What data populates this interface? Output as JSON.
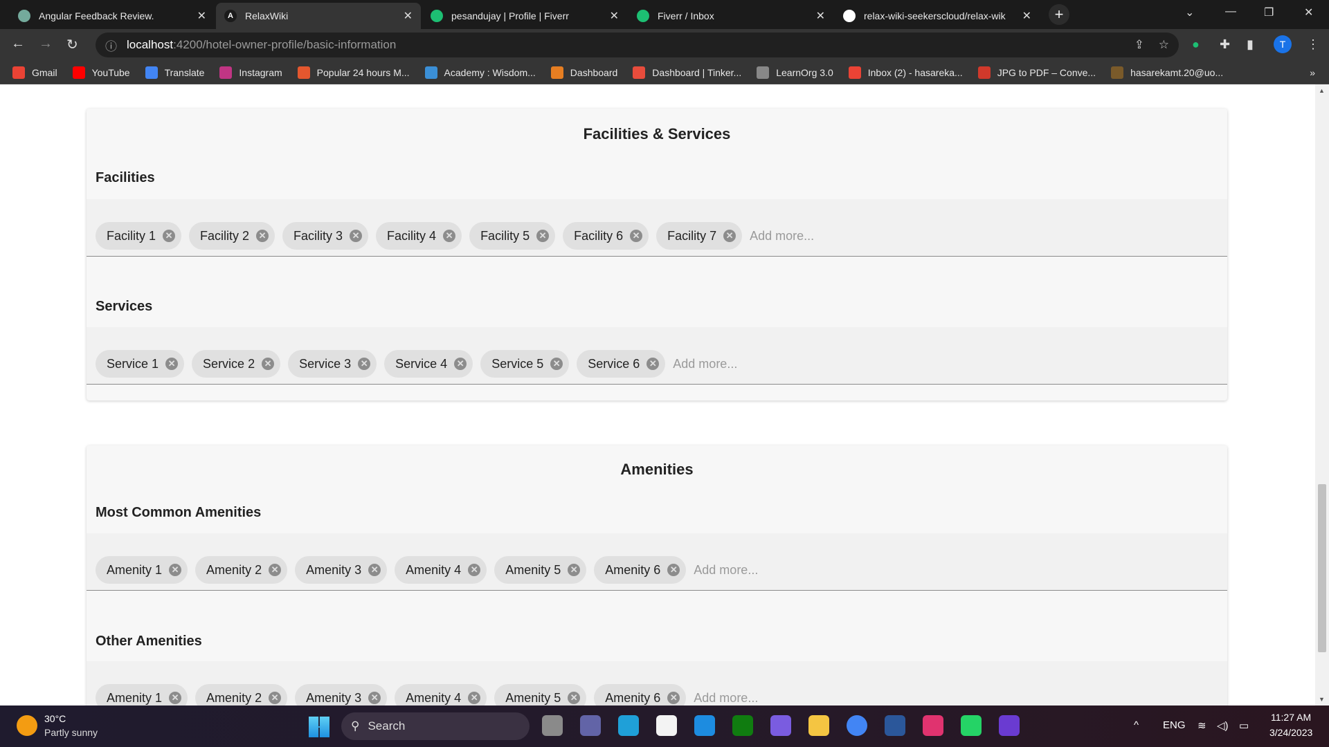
{
  "browser": {
    "tabs": [
      {
        "title": "Angular Feedback Review.",
        "icon": "chatgpt-icon",
        "color": "#74aa9c"
      },
      {
        "title": "RelaxWiki",
        "icon": "angular-icon",
        "color": "#1b1b1b",
        "active": true
      },
      {
        "title": "pesandujay | Profile | Fiverr",
        "icon": "fiverr-icon",
        "color": "#1dbf73"
      },
      {
        "title": "Fiverr / Inbox",
        "icon": "fiverr-icon",
        "color": "#1dbf73"
      },
      {
        "title": "relax-wiki-seekerscloud/relax-wik",
        "icon": "github-icon",
        "color": "#ffffff"
      }
    ],
    "url_host": "localhost",
    "url_path": ":4200/hotel-owner-profile/basic-information",
    "profile_initial": "T",
    "bookmarks": [
      {
        "label": "Gmail",
        "color": "#ea4335"
      },
      {
        "label": "YouTube",
        "color": "#ff0000"
      },
      {
        "label": "Translate",
        "color": "#4285f4"
      },
      {
        "label": "Instagram",
        "color": "#c13584"
      },
      {
        "label": "Popular 24 hours M...",
        "color": "#e4572e"
      },
      {
        "label": "Academy : Wisdom...",
        "color": "#3b8fd6"
      },
      {
        "label": "Dashboard",
        "color": "#e67e22"
      },
      {
        "label": "Dashboard | Tinker...",
        "color": "#e74c3c"
      },
      {
        "label": "LearnOrg 3.0",
        "color": "#888888"
      },
      {
        "label": "Inbox (2) - hasareka...",
        "color": "#ea4335"
      },
      {
        "label": "JPG to PDF – Conve...",
        "color": "#d0392b"
      },
      {
        "label": "hasarekamt.20@uo...",
        "color": "#7a5a2a"
      }
    ],
    "bookmarks_overflow": "»"
  },
  "facilities_services": {
    "title": "Facilities & Services",
    "facilities_label": "Facilities",
    "facilities": [
      "Facility 1",
      "Facility 2",
      "Facility 3",
      "Facility 4",
      "Facility 5",
      "Facility 6",
      "Facility 7"
    ],
    "services_label": "Services",
    "services": [
      "Service 1",
      "Service 2",
      "Service 3",
      "Service 4",
      "Service 5",
      "Service 6"
    ],
    "add_placeholder": "Add more..."
  },
  "amenities": {
    "title": "Amenities",
    "common_label": "Most Common Amenities",
    "common": [
      "Amenity 1",
      "Amenity 2",
      "Amenity 3",
      "Amenity 4",
      "Amenity 5",
      "Amenity 6"
    ],
    "other_label": "Other Amenities",
    "other": [
      "Amenity 1",
      "Amenity 2",
      "Amenity 3",
      "Amenity 4",
      "Amenity 5",
      "Amenity 6"
    ],
    "add_placeholder": "Add more..."
  },
  "taskbar": {
    "weather_temp": "30°C",
    "weather_desc": "Partly sunny",
    "search_label": "Search",
    "apps": [
      {
        "name": "file-viewer",
        "color": "#8a8a8a"
      },
      {
        "name": "teams",
        "color": "#6264a7"
      },
      {
        "name": "edge",
        "color": "#1fa0d8"
      },
      {
        "name": "store",
        "color": "#f3f3f3"
      },
      {
        "name": "mail",
        "color": "#1d8ce0"
      },
      {
        "name": "xbox",
        "color": "#107c10"
      },
      {
        "name": "copilot",
        "color": "#7a5ce0"
      },
      {
        "name": "file-explorer",
        "color": "#f4c542"
      },
      {
        "name": "chrome",
        "color": "#4285f4"
      },
      {
        "name": "word",
        "color": "#2b579a"
      },
      {
        "name": "intellij",
        "color": "#e0336f"
      },
      {
        "name": "whatsapp",
        "color": "#25d366"
      },
      {
        "name": "visual-studio",
        "color": "#6a3bd1"
      }
    ],
    "language": "ENG",
    "time": "11:27 AM",
    "date": "3/24/2023"
  }
}
